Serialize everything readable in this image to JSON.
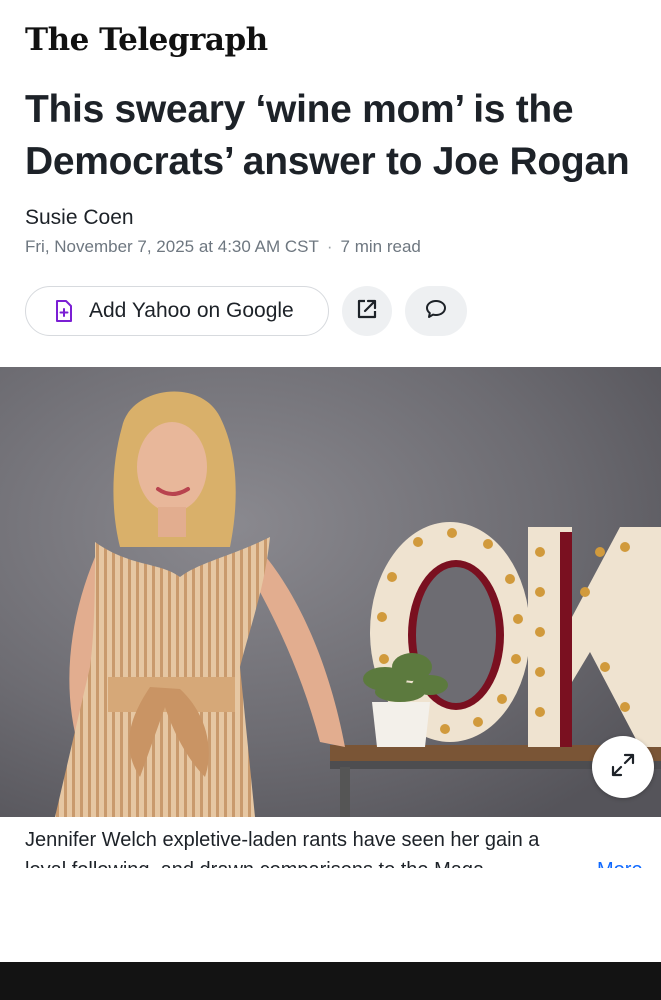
{
  "masthead": "The Telegraph",
  "headline": "This sweary ‘wine mom’ is the Democrats’ answer to Joe Rogan",
  "author": "Susie Coen",
  "meta": {
    "date": "Fri, November 7, 2025 at 4:30 AM CST",
    "separator": "·",
    "read_time": "7 min read"
  },
  "actions": {
    "add_google_label": "Add Yahoo on Google",
    "add_google_icon": "document-plus-icon",
    "share_icon": "external-share-icon",
    "comment_icon": "comment-bubble-icon"
  },
  "hero": {
    "sign_text": "OK",
    "expand_icon": "expand-arrows-icon"
  },
  "caption": {
    "line1": "Jennifer Welch expletive-laden rants have seen her gain a",
    "line2": "loyal following, and drawn comparisons to the Maga",
    "more": "More"
  },
  "colors": {
    "accent_purple": "#7b1fd4",
    "link_blue": "#0f69ff",
    "text_dark": "#1d2228",
    "meta_gray": "#6e7780",
    "bottom_bar": "#131313"
  }
}
